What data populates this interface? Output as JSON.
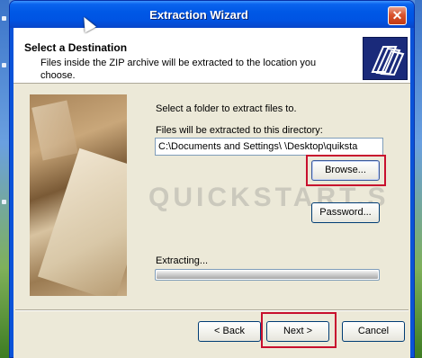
{
  "window": {
    "title": "Extraction Wizard",
    "close_glyph": "✕"
  },
  "header": {
    "title": "Select a Destination",
    "subtitle": "Files inside the ZIP archive will be extracted to the location you choose.",
    "icon": "folder-stack-icon"
  },
  "form": {
    "prompt": "Select a folder to extract files to.",
    "dir_label": "Files will be extracted to this directory:",
    "path_value": "C:\\Documents and Settings\\        \\Desktop\\quiksta",
    "browse_label": "Browse...",
    "password_label": "Password...",
    "extracting_label": "Extracting...",
    "progress_fraction": 1.0
  },
  "footer": {
    "back_label": "< Back",
    "next_label": "Next >",
    "cancel_label": "Cancel"
  },
  "watermark": "QUICKSTART.S",
  "colors": {
    "titlebar": "#0054e3",
    "client_bg": "#ece9d8",
    "highlight_frame": "#c8102e"
  }
}
